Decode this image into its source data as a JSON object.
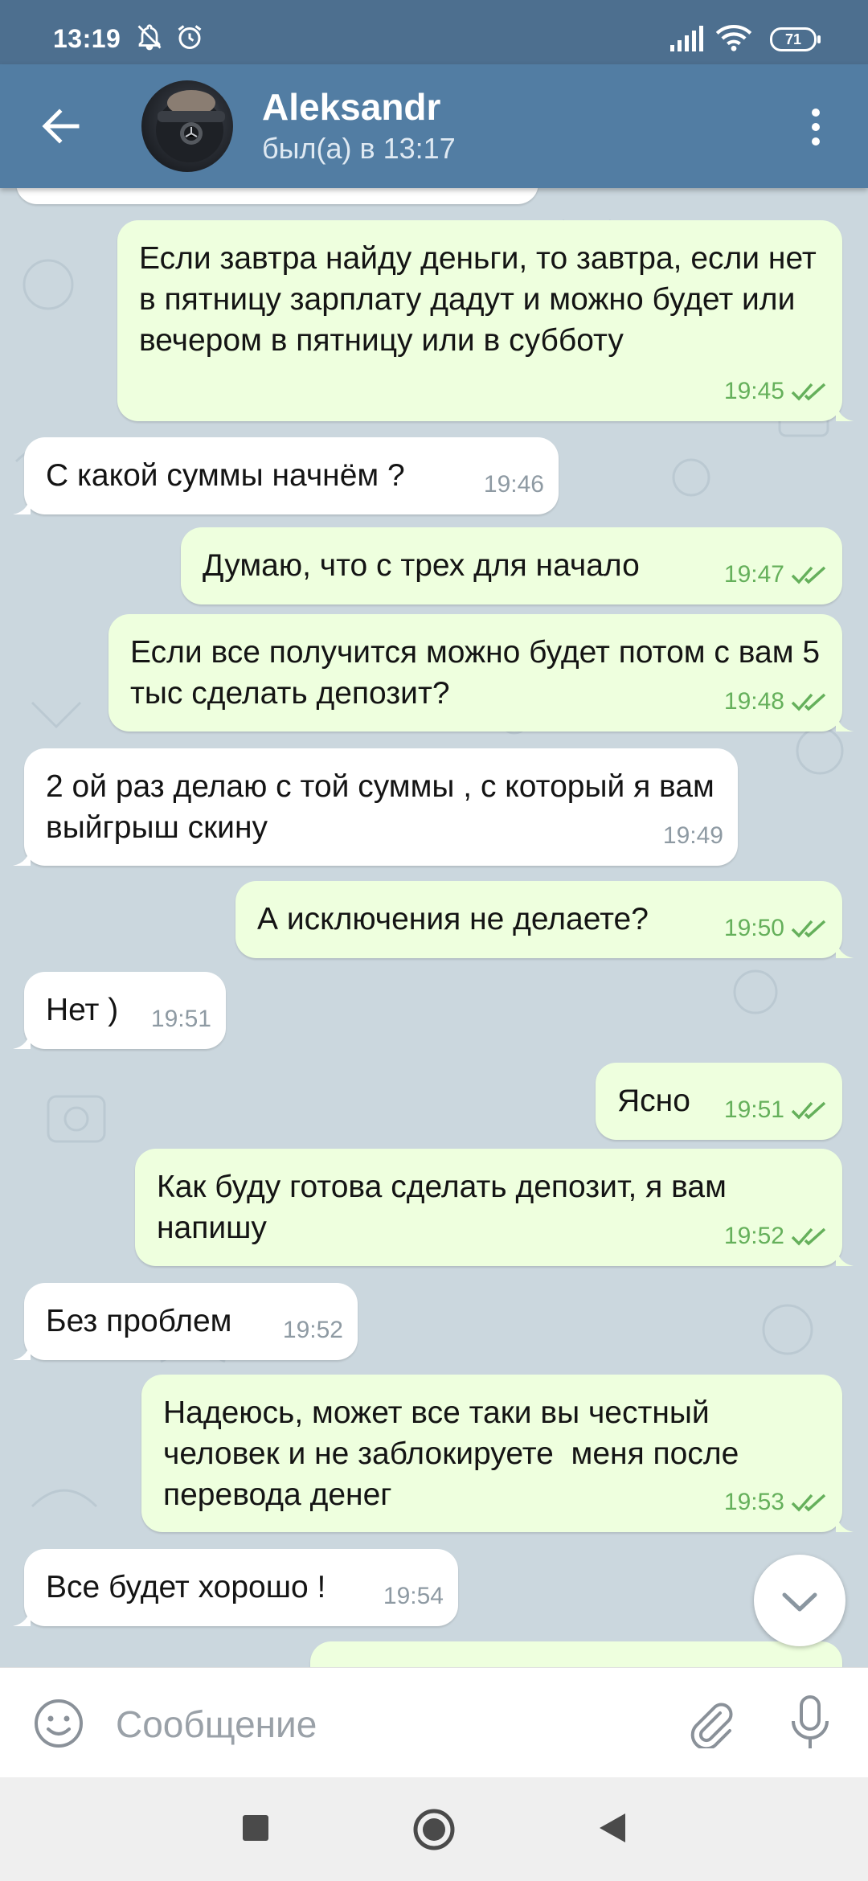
{
  "status_bar": {
    "time": "13:19",
    "battery": "71",
    "icons": [
      "bell-off-icon",
      "alarm-icon",
      "signal-icon",
      "wifi-icon",
      "battery-icon"
    ]
  },
  "header": {
    "name": "Aleksandr",
    "status": "был(а) в 13:17"
  },
  "messages": [
    {
      "dir": "out",
      "text": "Если завтра найду деньги, то завтра, если нет в пятницу зарплату дадут и можно будет или вечером в пятницу или в субботу",
      "time": "19:45"
    },
    {
      "dir": "in",
      "text": "С какой суммы начнём ?",
      "time": "19:46"
    },
    {
      "dir": "out",
      "text": "Думаю, что с трех для начало",
      "time": "19:47"
    },
    {
      "dir": "out",
      "text": "Если все получится можно будет потом с вам 5 тыс сделать депозит?",
      "time": "19:48"
    },
    {
      "dir": "in",
      "text": "2 ой раз делаю с той суммы , с который я вам выйгрыш скину",
      "time": "19:49"
    },
    {
      "dir": "out",
      "text": "А исключения не делаете?",
      "time": "19:50"
    },
    {
      "dir": "in",
      "text": "Нет )",
      "time": "19:51"
    },
    {
      "dir": "out",
      "text": "Ясно",
      "time": "19:51"
    },
    {
      "dir": "out",
      "text": "Как буду готова сделать депозит, я вам напишу",
      "time": "19:52"
    },
    {
      "dir": "in",
      "text": "Без проблем",
      "time": "19:52"
    },
    {
      "dir": "out",
      "text": "Надеюсь, может все таки вы честный человек и не заблокируете  меня после перевода денег",
      "time": "19:53"
    },
    {
      "dir": "in",
      "text": "Все будет хорошо !",
      "time": "19:54"
    }
  ],
  "input": {
    "placeholder": "Сообщение"
  },
  "colors": {
    "header": "#527da3",
    "status_bar": "#4d6f8f",
    "chat_bg": "#cbd7de",
    "outgoing_bubble": "#eeffde",
    "incoming_bubble": "#ffffff",
    "outgoing_meta": "#65b05b"
  }
}
